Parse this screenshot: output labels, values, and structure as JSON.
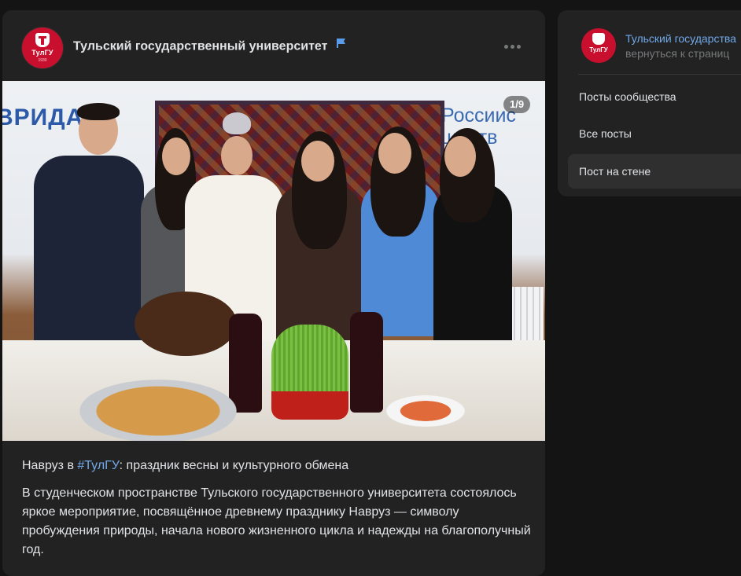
{
  "post": {
    "community_name": "Тульский государственный университет",
    "avatar_text": "ТулГУ",
    "avatar_year": "1930",
    "photo_counter": "1/9",
    "photo_brand_left": "ВРИДА",
    "photo_brand_right": "Россиис\nществ\nние",
    "title_prefix": "Навруз в ",
    "title_hashtag": "#ТулГУ",
    "title_suffix": ": праздник весны и культурного обмена",
    "body": "В студенческом пространстве Тульского государственного университета состоялось яркое мероприятие, посвящённое древнему празднику Навруз — символу пробуждения природы, начала нового жизненного цикла и надежды на благополучный год."
  },
  "sidebar": {
    "community_name": "Тульский государства",
    "back_link": "вернуться к страниц",
    "items": [
      {
        "label": "Посты сообщества",
        "active": false
      },
      {
        "label": "Все посты",
        "active": false
      },
      {
        "label": "Пост на стене",
        "active": true
      }
    ]
  },
  "colors": {
    "background": "#141414",
    "card": "#222222",
    "accent_link": "#71aaeb",
    "brand_red": "#c8102e",
    "text": "#e1e3e6",
    "muted": "#76787a"
  }
}
